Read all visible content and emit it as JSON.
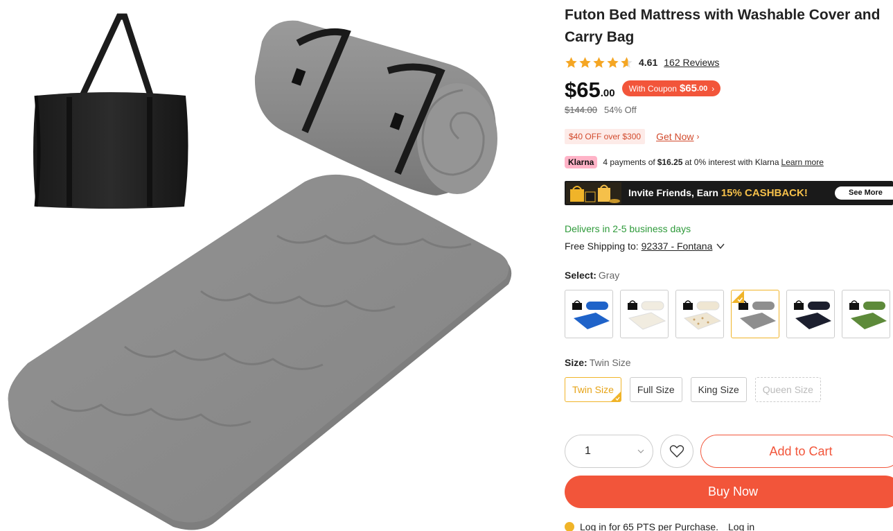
{
  "product": {
    "title": "Futon Bed Mattress with Washable Cover and Carry Bag",
    "rating": "4.61",
    "rating_value": 4.61,
    "reviews_label": "162 Reviews"
  },
  "price": {
    "main": "$65",
    "cents": ".00",
    "coupon_label": "With Coupon",
    "coupon_amount": "$65",
    "coupon_cents": ".00",
    "was": "$144.00",
    "discount": "54% Off"
  },
  "promo": {
    "badge": "$40 OFF over $300",
    "link": "Get Now"
  },
  "klarna": {
    "logo": "Klarna",
    "pre": "4 payments of",
    "amount": "$16.25",
    "post": "at 0% interest with Klarna",
    "learn_more": "Learn more"
  },
  "banner": {
    "text": "Invite Friends, Earn",
    "highlight": "15% CASHBACK!",
    "button": "See More"
  },
  "delivery": {
    "delivers": "Delivers in 2-5 business days",
    "shipping_label": "Free Shipping to:",
    "zip": "92337 - Fontana"
  },
  "color": {
    "label": "Select:",
    "value": "Gray",
    "options": [
      {
        "name": "blue",
        "color": "#1f63c9"
      },
      {
        "name": "cream",
        "color": "#f1ece0"
      },
      {
        "name": "floral",
        "color": "#efe6d2"
      },
      {
        "name": "gray",
        "color": "#8e8e8e",
        "selected": true
      },
      {
        "name": "navy",
        "color": "#1c1f2e"
      },
      {
        "name": "green",
        "color": "#5d8a3a"
      }
    ]
  },
  "size": {
    "label": "Size:",
    "value": "Twin Size",
    "options": [
      "Twin Size",
      "Full Size",
      "King Size",
      "Queen Size"
    ]
  },
  "actions": {
    "quantity": "1",
    "add_to_cart": "Add to Cart",
    "buy_now": "Buy Now"
  },
  "points": {
    "text": "Log in for 65 PTS per Purchase.",
    "login": "Log in"
  },
  "colors": {
    "accent": "#f2553a",
    "green": "#2e9a3a",
    "selected": "#f0b429",
    "star": "#f5a623"
  }
}
